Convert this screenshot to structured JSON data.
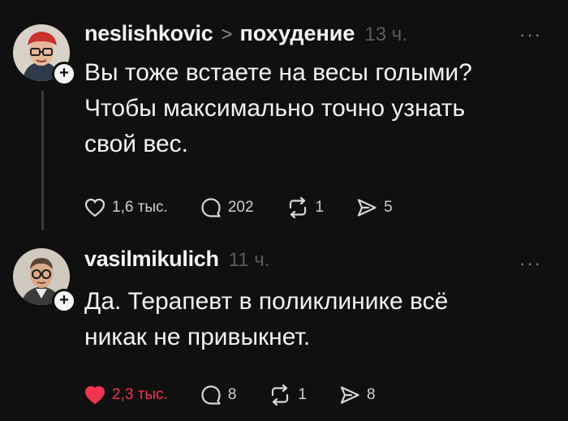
{
  "posts": [
    {
      "username": "neslishkovic",
      "separator": ">",
      "topic": "похудение",
      "time": "13 ч.",
      "more": "···",
      "lines": [
        "Вы тоже встаете на весы голыми?",
        "Чтобы максимально точно узнать",
        "свой вес."
      ],
      "likes": "1,6 тыс.",
      "replies": "202",
      "reposts": "1",
      "shares": "5",
      "liked": false
    },
    {
      "username": "vasilmikulich",
      "time": "11 ч.",
      "more": "···",
      "lines": [
        "Да. Терапевт в поликлинике всё",
        "никак не привыкнет."
      ],
      "likes": "2,3 тыс.",
      "replies": "8",
      "reposts": "1",
      "shares": "8",
      "liked": true
    }
  ],
  "icons": {
    "follow": "plus-icon",
    "like": "heart-icon",
    "reply": "comment-icon",
    "repost": "repost-icon",
    "share": "send-icon"
  },
  "colors": {
    "background": "#101010",
    "text": "#f3f3f3",
    "muted": "#8a8a8a",
    "like_active": "#f2344f"
  }
}
